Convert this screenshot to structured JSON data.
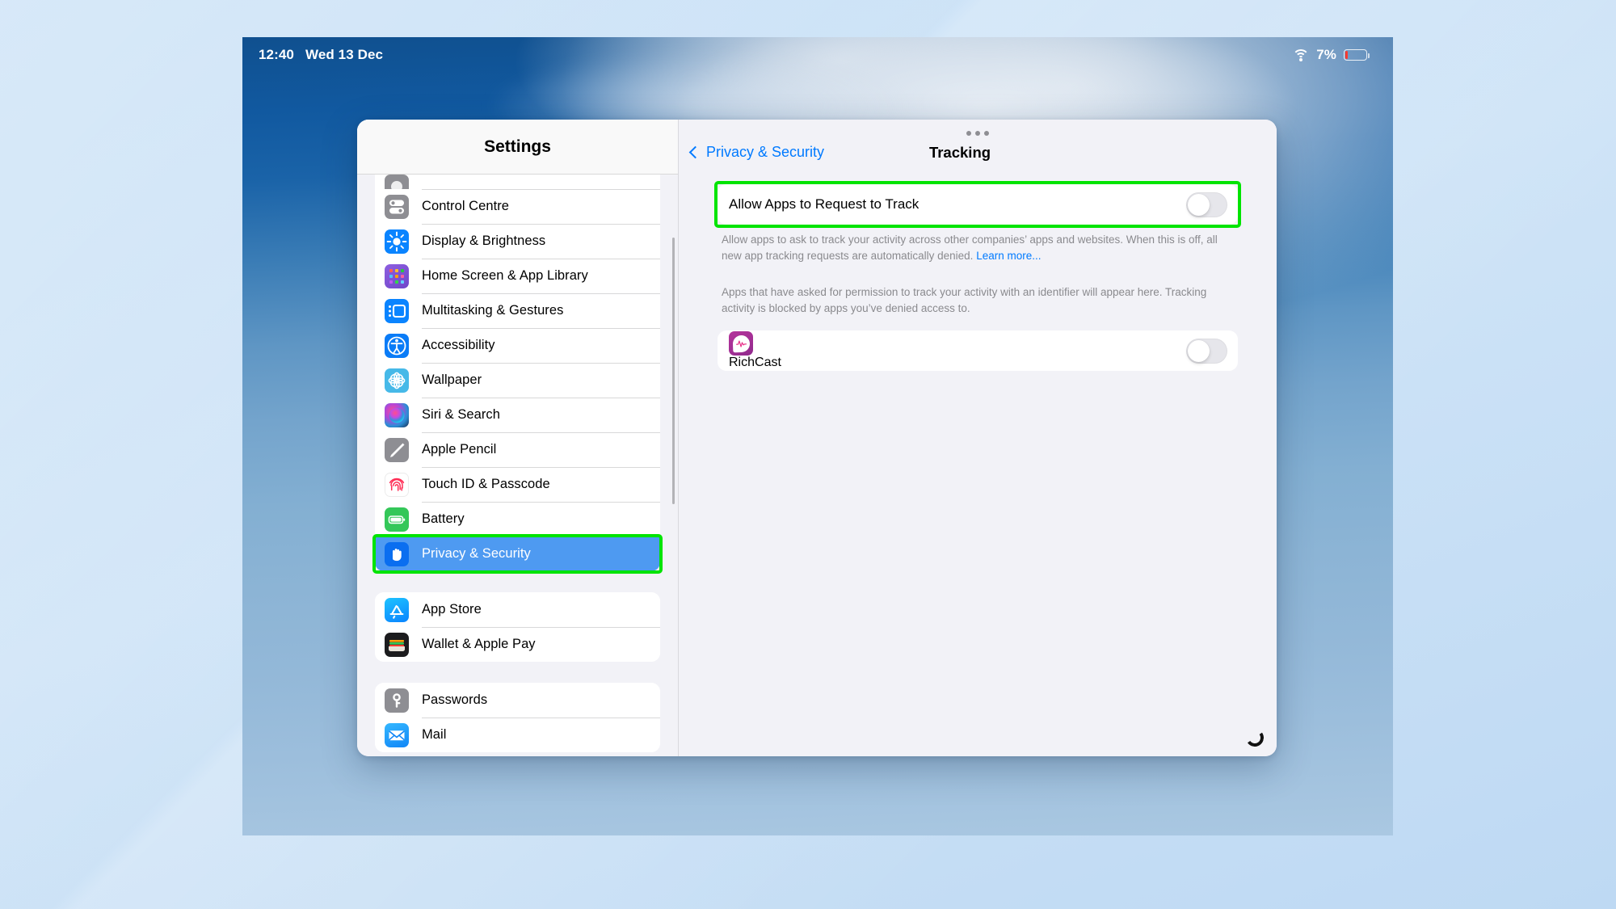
{
  "status_bar": {
    "time": "12:40",
    "date": "Wed 13 Dec",
    "battery_percent": "7%",
    "wifi_icon": "wifi-icon",
    "battery_icon": "battery-low-icon"
  },
  "sidebar": {
    "title": "Settings",
    "groups": [
      {
        "partial_top": true,
        "items": [
          {
            "label": "",
            "icon": "partial-settings-icon",
            "clipped": true,
            "icon_class": "ic-part"
          },
          {
            "label": "Control Centre",
            "icon": "control-centre-icon",
            "icon_class": "ic-control"
          },
          {
            "label": "Display & Brightness",
            "icon": "display-brightness-icon",
            "icon_class": "ic-display"
          },
          {
            "label": "Home Screen & App Library",
            "icon": "home-screen-icon",
            "icon_class": "ic-home"
          },
          {
            "label": "Multitasking & Gestures",
            "icon": "multitasking-icon",
            "icon_class": "ic-multi"
          },
          {
            "label": "Accessibility",
            "icon": "accessibility-icon",
            "icon_class": "ic-access"
          },
          {
            "label": "Wallpaper",
            "icon": "wallpaper-icon",
            "icon_class": "ic-wall"
          },
          {
            "label": "Siri & Search",
            "icon": "siri-search-icon",
            "icon_class": "ic-siri"
          },
          {
            "label": "Apple Pencil",
            "icon": "apple-pencil-icon",
            "icon_class": "ic-pencil"
          },
          {
            "label": "Touch ID & Passcode",
            "icon": "touch-id-icon",
            "icon_class": "ic-touch"
          },
          {
            "label": "Battery",
            "icon": "battery-icon",
            "icon_class": "ic-batt"
          },
          {
            "label": "Privacy & Security",
            "icon": "privacy-security-icon",
            "icon_class": "ic-privacy",
            "selected": true,
            "highlighted": true
          }
        ]
      },
      {
        "items": [
          {
            "label": "App Store",
            "icon": "app-store-icon",
            "icon_class": "ic-appstore"
          },
          {
            "label": "Wallet & Apple Pay",
            "icon": "wallet-apple-pay-icon",
            "icon_class": "ic-wallet"
          }
        ]
      },
      {
        "items": [
          {
            "label": "Passwords",
            "icon": "passwords-icon",
            "icon_class": "ic-pass"
          },
          {
            "label": "Mail",
            "icon": "mail-icon",
            "icon_class": "ic-mail"
          }
        ]
      }
    ]
  },
  "detail": {
    "back_label": "Privacy & Security",
    "title": "Tracking",
    "toggle_row": {
      "label": "Allow Apps to Request to Track",
      "state": "off",
      "highlighted": true
    },
    "footnote_1": "Allow apps to ask to track your activity across other companies’ apps and websites. When this is off, all new app tracking requests are automatically denied. ",
    "footnote_1_link": "Learn more...",
    "footnote_2": "Apps that have asked for permission to track your activity with an identifier will appear here. Tracking activity is blocked by apps you’ve denied access to.",
    "apps": [
      {
        "name": "RichCast",
        "icon": "richcast-app-icon",
        "state": "off"
      }
    ]
  },
  "colors": {
    "accent_blue": "#007aff",
    "selection_blue": "#4e9af1",
    "highlight_green": "#00e400",
    "footnote_grey": "#8a8a8e"
  }
}
